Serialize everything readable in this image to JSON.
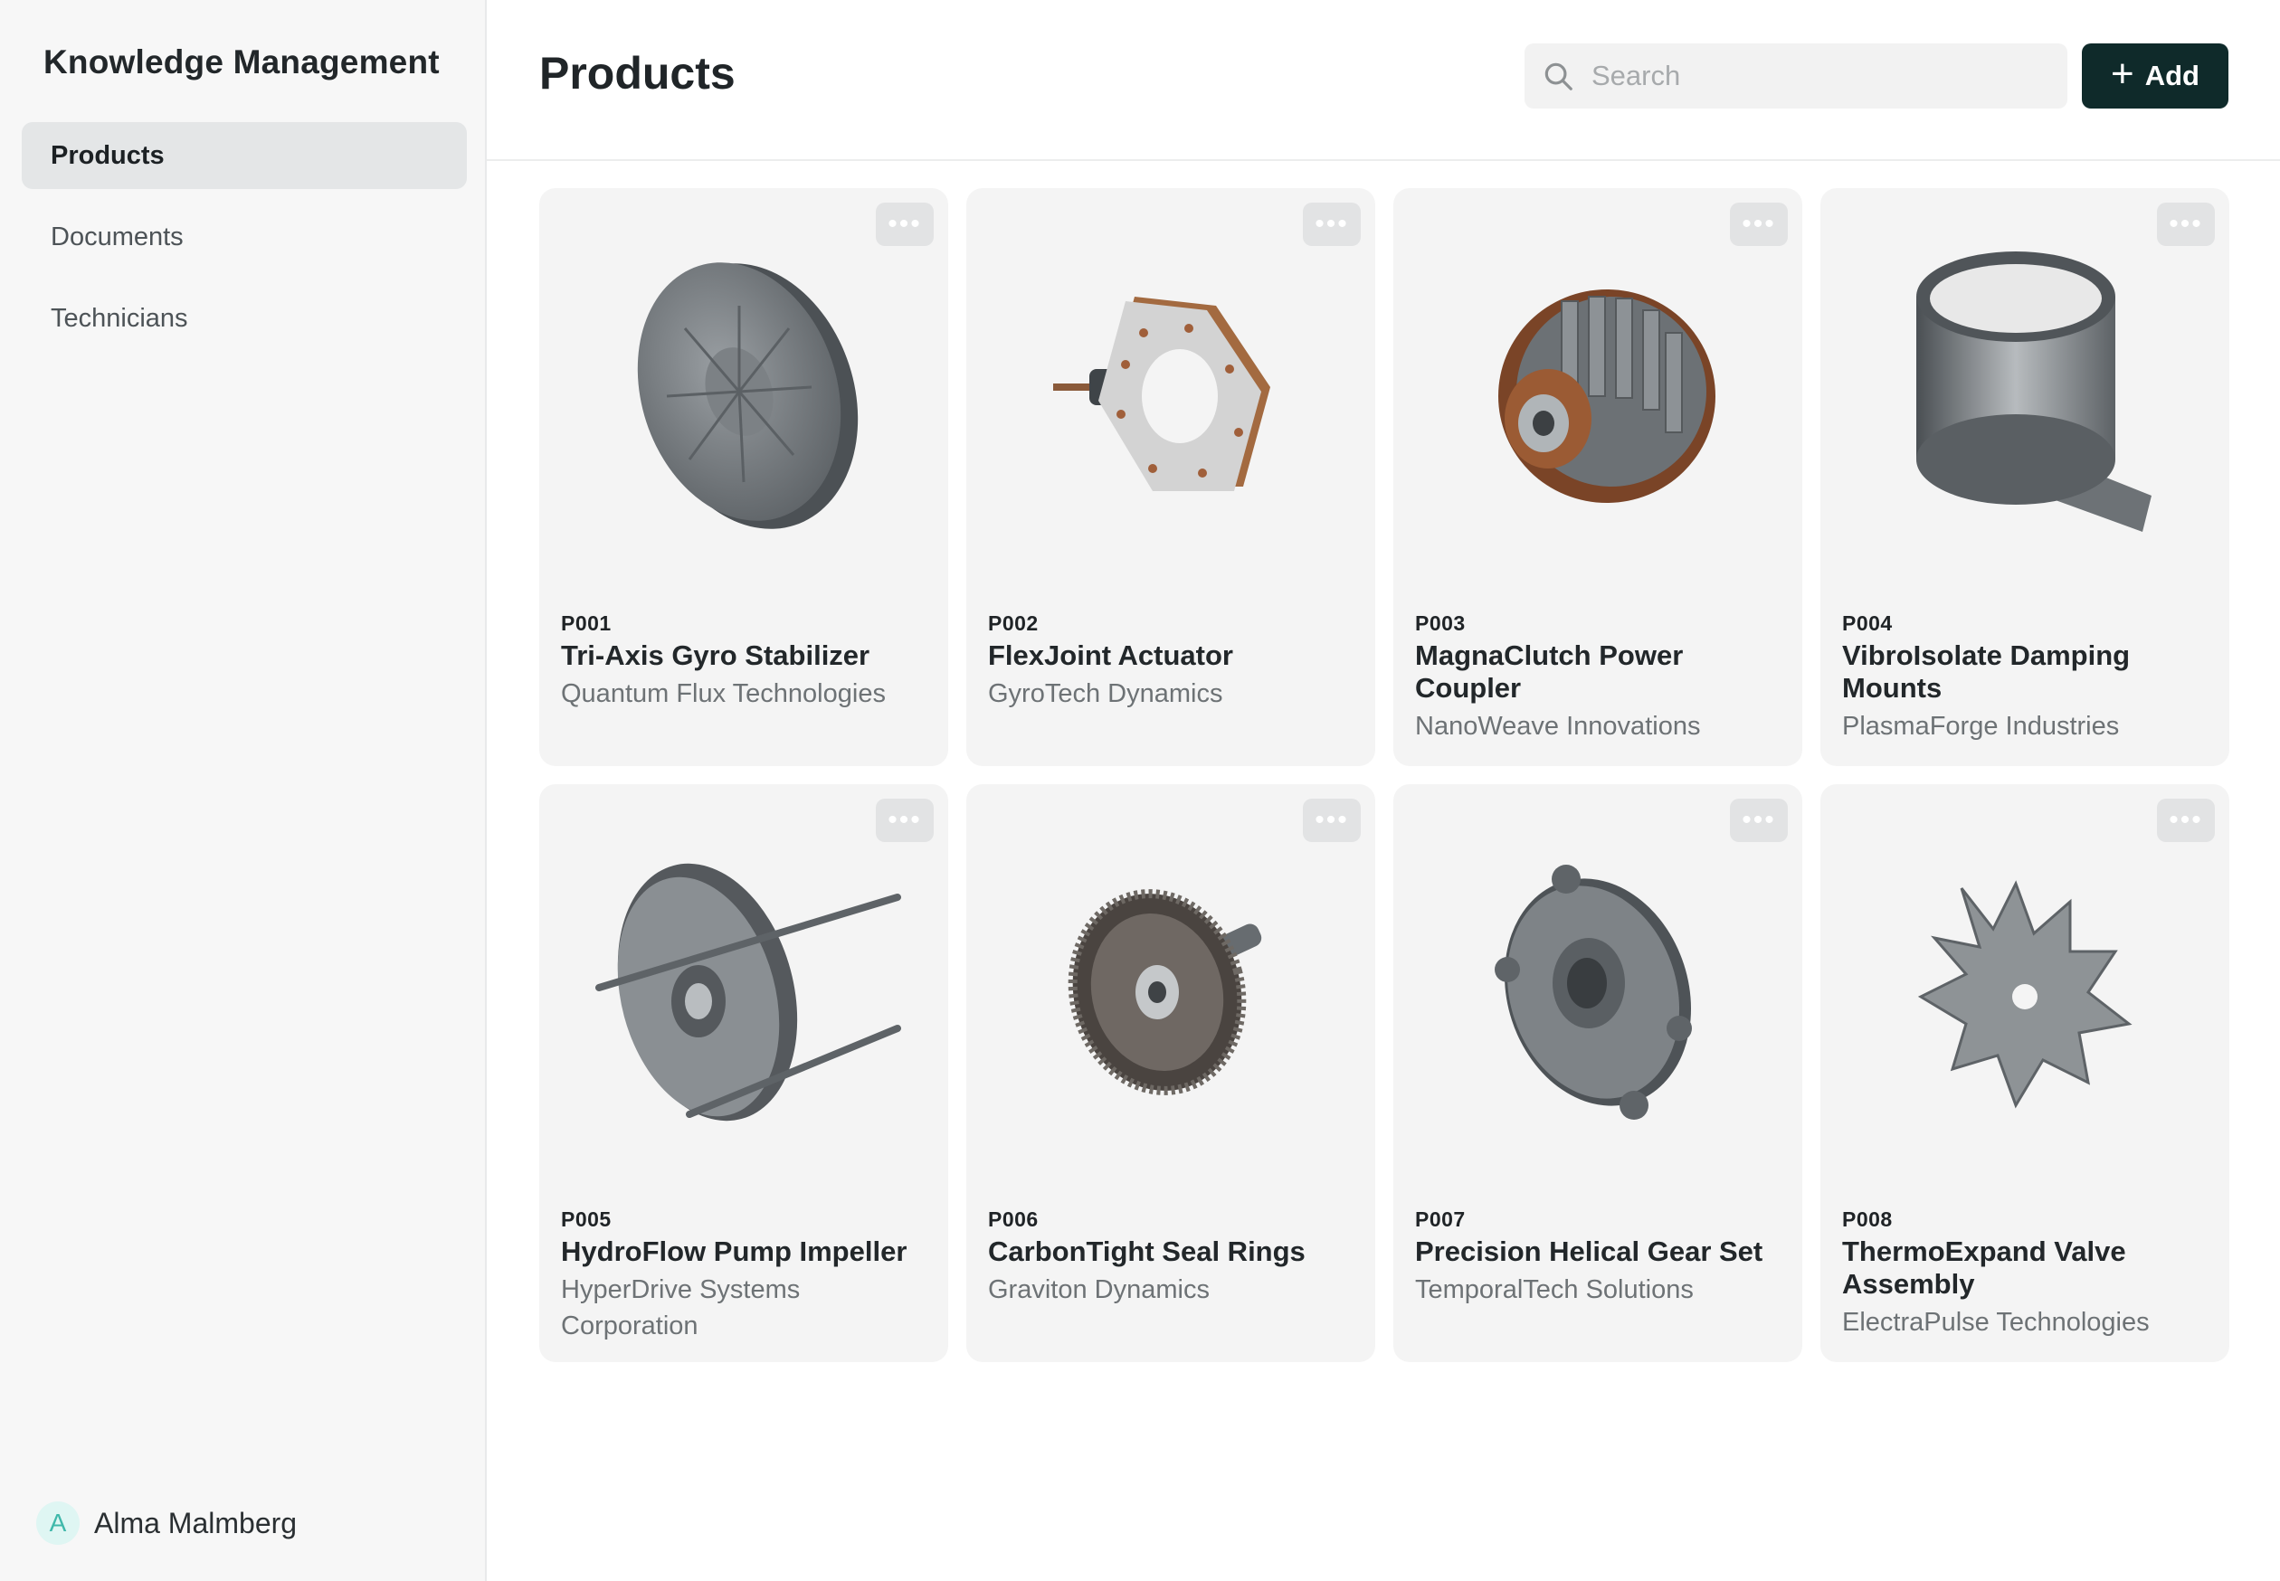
{
  "app": {
    "title": "Knowledge Management"
  },
  "sidebar": {
    "items": [
      {
        "label": "Products",
        "active": true
      },
      {
        "label": "Documents",
        "active": false
      },
      {
        "label": "Technicians",
        "active": false
      }
    ],
    "user": {
      "initial": "A",
      "name": "Alma Malmberg"
    }
  },
  "header": {
    "title": "Products",
    "search_placeholder": "Search",
    "add_label": "Add"
  },
  "products": [
    {
      "id": "P001",
      "name": "Tri-Axis Gyro Stabilizer",
      "company": "Quantum Flux Technologies",
      "icon": "disc-part-icon"
    },
    {
      "id": "P002",
      "name": "FlexJoint Actuator",
      "company": "GyroTech Dynamics",
      "icon": "plate-part-icon"
    },
    {
      "id": "P003",
      "name": "MagnaClutch Power Coupler",
      "company": "NanoWeave Innovations",
      "icon": "stator-part-icon"
    },
    {
      "id": "P004",
      "name": "VibroIsolate Damping Mounts",
      "company": "PlasmaForge Industries",
      "icon": "cylinder-part-icon"
    },
    {
      "id": "P005",
      "name": "HydroFlow Pump Impeller",
      "company": "HyperDrive Systems Corporation",
      "icon": "housing-part-icon"
    },
    {
      "id": "P006",
      "name": "CarbonTight Seal Rings",
      "company": "Graviton Dynamics",
      "icon": "gear-part-icon"
    },
    {
      "id": "P007",
      "name": "Precision Helical Gear Set",
      "company": "TemporalTech Solutions",
      "icon": "flange-part-icon"
    },
    {
      "id": "P008",
      "name": "ThermoExpand Valve Assembly",
      "company": "ElectraPulse Technologies",
      "icon": "star-part-icon"
    }
  ]
}
